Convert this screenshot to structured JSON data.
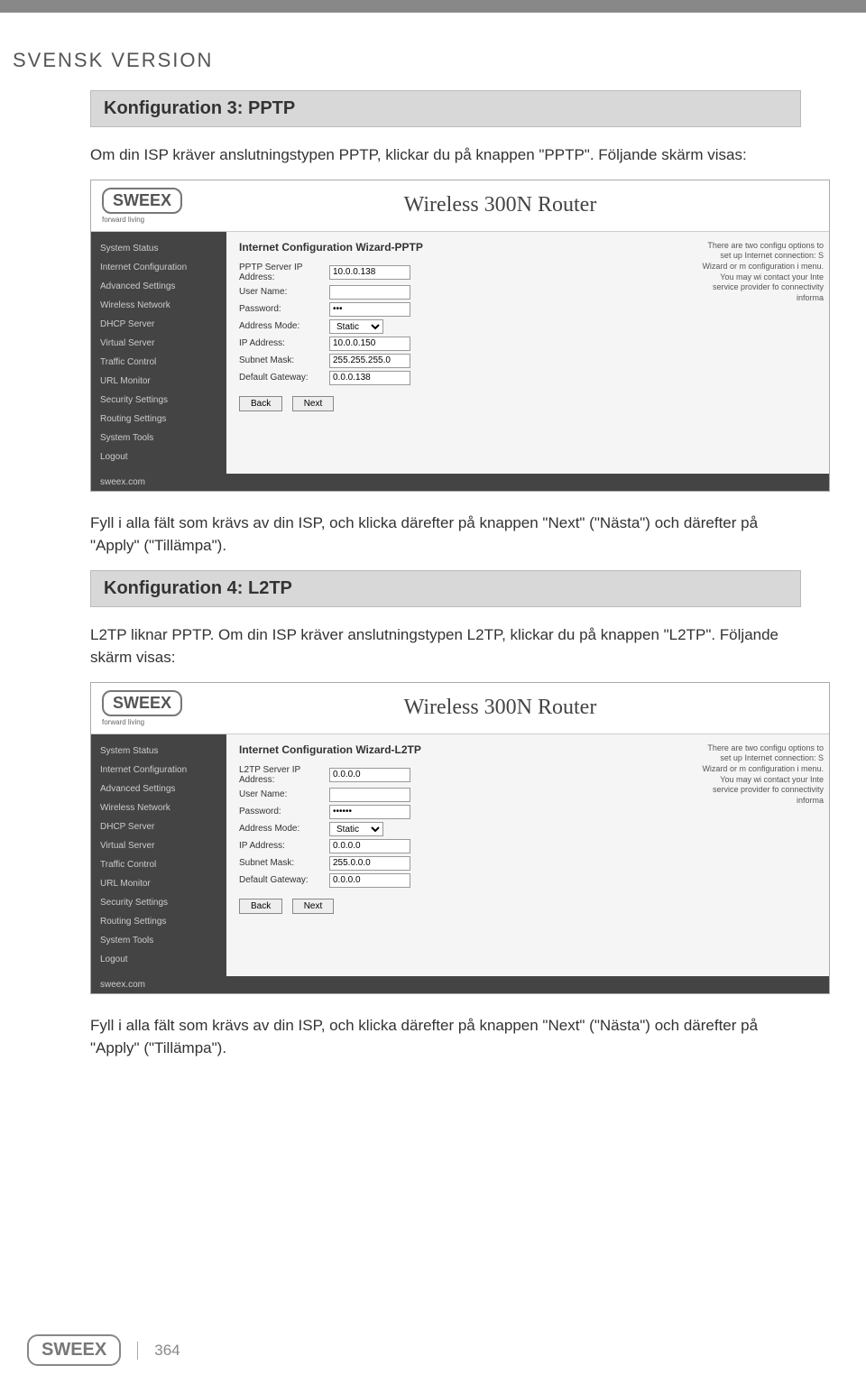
{
  "header": "SVENSK VERSION",
  "section3": {
    "title": "Konfiguration 3: PPTP",
    "intro": "Om din ISP kräver anslutningstypen PPTP, klickar du på knappen \"PPTP\". Följande skärm visas:",
    "outro": "Fyll i alla fält som krävs av din ISP, och klicka därefter på knappen \"Next\" (\"Nästa\") och därefter på \"Apply\" (\"Tillämpa\")."
  },
  "section4": {
    "title": "Konfiguration 4: L2TP",
    "intro": "L2TP liknar PPTP. Om din ISP kräver anslutningstypen L2TP, klickar du på knappen \"L2TP\". Följande skärm visas:",
    "outro": "Fyll i alla fält som krävs av din ISP, och klicka därefter på knappen \"Next\" (\"Nästa\") och därefter på \"Apply\" (\"Tillämpa\")."
  },
  "screenshot": {
    "logo": "SWEEX",
    "logoSub": "forward living",
    "routerTitle": "Wireless 300N Router",
    "sidebar": [
      "System Status",
      "Internet Configuration",
      "Advanced Settings",
      "Wireless Network",
      "DHCP Server",
      "Virtual Server",
      "Traffic Control",
      "URL Monitor",
      "Security Settings",
      "Routing Settings",
      "System Tools",
      "Logout"
    ],
    "footer": "sweex.com",
    "infoText": "There are two configu options to set up Internet connection: S Wizard or m configuration i menu. You may wi contact your Inte service provider fo connectivity informa",
    "buttons": {
      "back": "Back",
      "next": "Next"
    }
  },
  "wizard_pptp": {
    "title": "Internet Configuration Wizard-PPTP",
    "fields": {
      "server_label": "PPTP Server IP Address:",
      "server_val": "10.0.0.138",
      "user_label": "User Name:",
      "user_val": "",
      "pass_label": "Password:",
      "pass_val": "•••",
      "mode_label": "Address Mode:",
      "mode_val": "Static",
      "ip_label": "IP Address:",
      "ip_val": "10.0.0.150",
      "mask_label": "Subnet Mask:",
      "mask_val": "255.255.255.0",
      "gw_label": "Default Gateway:",
      "gw_val": "0.0.0.138"
    }
  },
  "wizard_l2tp": {
    "title": "Internet Configuration Wizard-L2TP",
    "fields": {
      "server_label": "L2TP Server IP Address:",
      "server_val": "0.0.0.0",
      "user_label": "User Name:",
      "user_val": "",
      "pass_label": "Password:",
      "pass_val": "••••••",
      "mode_label": "Address Mode:",
      "mode_val": "Static",
      "ip_label": "IP Address:",
      "ip_val": "0.0.0.0",
      "mask_label": "Subnet Mask:",
      "mask_val": "255.0.0.0",
      "gw_label": "Default Gateway:",
      "gw_val": "0.0.0.0"
    }
  },
  "pageNumber": "364"
}
